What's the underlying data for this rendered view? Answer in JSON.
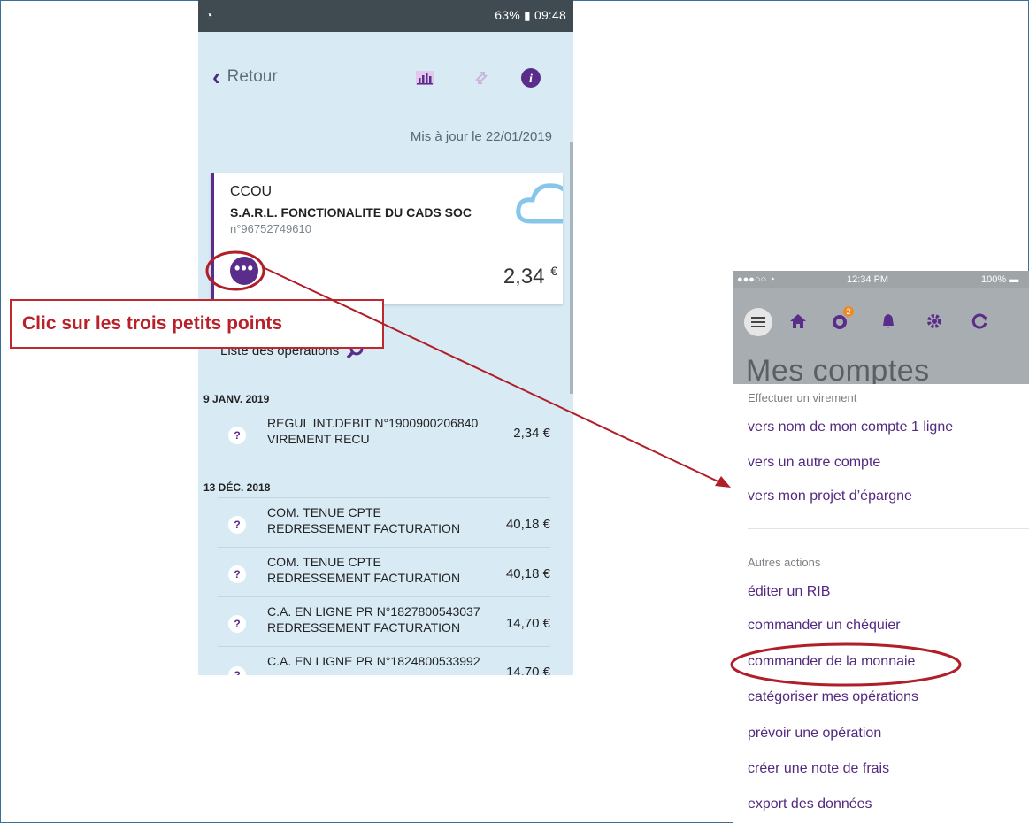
{
  "android": {
    "status_right": "63% ▮ 09:48",
    "back_label": "Retour",
    "updated": "Mis à jour le 22/01/2019",
    "card": {
      "type": "CCOU",
      "name": "S.A.R.L. FONCTIONALITE DU CADS SOC",
      "number": "n°96752749610",
      "amount": "2,34",
      "currency": "€"
    },
    "operations_title": "Liste des opérations",
    "groups": [
      {
        "date": "9 JANV. 2019",
        "ops": [
          {
            "l1": "REGUL INT.DEBIT  N°1900900206840",
            "l2": "VIREMENT RECU",
            "amount": "2,34 €"
          }
        ]
      },
      {
        "date": "13 DÉC. 2018",
        "ops": [
          {
            "l1": "COM. TENUE CPTE",
            "l2": "REDRESSEMENT FACTURATION",
            "amount": "40,18 €"
          },
          {
            "l1": "COM. TENUE CPTE",
            "l2": "REDRESSEMENT FACTURATION",
            "amount": "40,18 €"
          },
          {
            "l1": "C.A. EN LIGNE PR N°1827800543037",
            "l2": "REDRESSEMENT FACTURATION",
            "amount": "14,70 €"
          },
          {
            "l1": "C.A. EN LIGNE PR N°1824800533992",
            "l2": "",
            "amount": "14,70 €"
          }
        ]
      }
    ]
  },
  "callout": "Clic sur les trois petits points",
  "ios": {
    "status_time": "12:34 PM",
    "status_battery": "100%",
    "header_title": "Mes comptes",
    "badge": "2",
    "section_transfer": "Effectuer un virement",
    "transfer_items": [
      "vers nom de mon compte 1 ligne",
      "vers un autre compte",
      "vers mon projet d’épargne"
    ],
    "section_other": "Autres actions",
    "other_items": [
      "éditer un RIB",
      "commander un chéquier",
      "commander de la monnaie",
      "catégoriser mes opérations",
      "prévoir une opération",
      "créer une note de frais",
      "export des données"
    ]
  },
  "colors": {
    "purple": "#5a2d8a",
    "annotation_red": "#c0282f",
    "phone_bg": "#d8eaf4"
  }
}
